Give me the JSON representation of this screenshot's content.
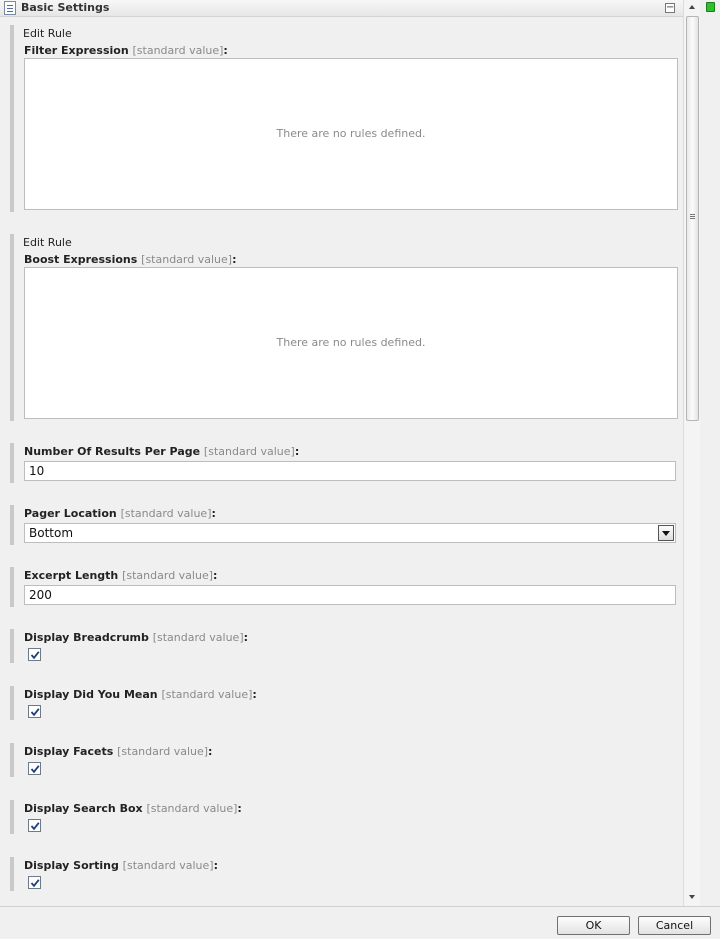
{
  "section": {
    "title": "Basic Settings",
    "icon": "section-icon",
    "collapse_icon": "minus-icon",
    "collapse_glyph": "−"
  },
  "std_suffix": "[standard value]",
  "filter_expression": {
    "edit_rule": "Edit Rule",
    "label": "Filter Expression",
    "empty_text": "There are no rules defined."
  },
  "boost_expressions": {
    "edit_rule": "Edit Rule",
    "label": "Boost Expressions",
    "empty_text": "There are no rules defined."
  },
  "results_per_page": {
    "label": "Number Of Results Per Page",
    "value": "10"
  },
  "pager_location": {
    "label": "Pager Location",
    "selected": "Bottom"
  },
  "excerpt_length": {
    "label": "Excerpt Length",
    "value": "200"
  },
  "checkboxes": [
    {
      "label": "Display Breadcrumb",
      "checked": true
    },
    {
      "label": "Display Did You Mean",
      "checked": true
    },
    {
      "label": "Display Facets",
      "checked": true
    },
    {
      "label": "Display Search Box",
      "checked": true
    },
    {
      "label": "Display Sorting",
      "checked": true
    }
  ],
  "footer": {
    "ok_label": "OK",
    "cancel_label": "Cancel"
  },
  "colors": {
    "status_indicator": "#2fbf2f",
    "panel_background": "#f0f0f0"
  }
}
